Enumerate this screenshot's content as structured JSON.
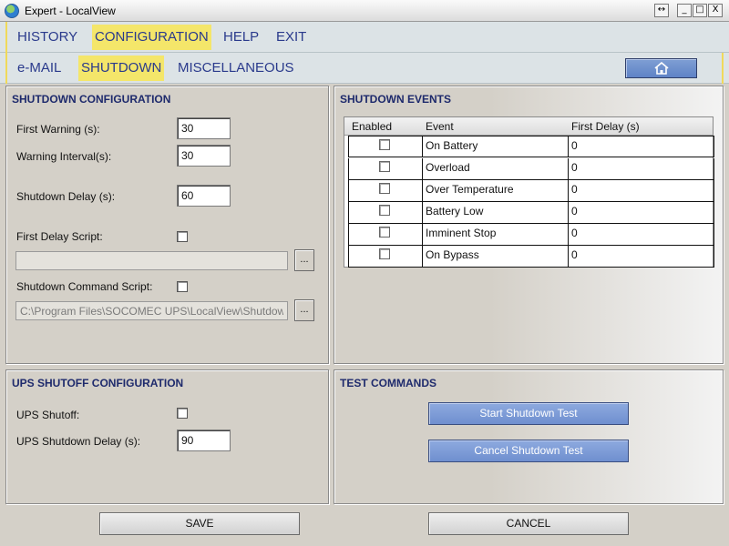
{
  "window": {
    "title": "Expert - LocalView",
    "controls": {
      "resize": "↔",
      "minimize": "_",
      "maximize": "□",
      "close": "X"
    }
  },
  "menu": {
    "main": [
      "HISTORY",
      "CONFIGURATION",
      "HELP",
      "EXIT"
    ],
    "main_active": "CONFIGURATION",
    "sub": [
      "e-MAIL",
      "SHUTDOWN",
      "MISCELLANEOUS"
    ],
    "sub_active": "SHUTDOWN",
    "home_icon": "home-icon"
  },
  "shutdown_config": {
    "title": "SHUTDOWN CONFIGURATION",
    "first_warning_label": "First Warning (s):",
    "first_warning_value": "30",
    "warning_interval_label": "Warning Interval(s):",
    "warning_interval_value": "30",
    "shutdown_delay_label": "Shutdown Delay (s):",
    "shutdown_delay_value": "60",
    "first_delay_script_label": "First Delay Script:",
    "first_delay_script_checked": false,
    "first_delay_script_path": "",
    "shutdown_command_script_label": "Shutdown Command Script:",
    "shutdown_command_script_checked": false,
    "shutdown_command_script_path": "C:\\Program Files\\SOCOMEC UPS\\LocalView\\Shutdown.l",
    "browse_label": "..."
  },
  "shutdown_events": {
    "title": "SHUTDOWN EVENTS",
    "columns": [
      "Enabled",
      "Event",
      "First Delay (s)"
    ],
    "rows": [
      {
        "enabled": false,
        "event": "On Battery",
        "delay": "0"
      },
      {
        "enabled": false,
        "event": "Overload",
        "delay": "0"
      },
      {
        "enabled": false,
        "event": "Over Temperature",
        "delay": "0"
      },
      {
        "enabled": false,
        "event": "Battery Low",
        "delay": "0"
      },
      {
        "enabled": false,
        "event": "Imminent Stop",
        "delay": "0"
      },
      {
        "enabled": false,
        "event": "On Bypass",
        "delay": "0"
      }
    ]
  },
  "ups_shutoff": {
    "title": "UPS SHUTOFF CONFIGURATION",
    "shutoff_label": "UPS Shutoff:",
    "shutoff_checked": false,
    "delay_label": "UPS Shutdown Delay (s):",
    "delay_value": "90"
  },
  "test_commands": {
    "title": "TEST COMMANDS",
    "start_label": "Start Shutdown Test",
    "cancel_label": "Cancel Shutdown Test"
  },
  "footer": {
    "save_label": "SAVE",
    "cancel_label": "CANCEL"
  },
  "colors": {
    "menu_text": "#2a3a8c",
    "menu_active_bg": "#f4e66a",
    "panel_title": "#1e2a6c",
    "blue_button": "#7a99d6"
  }
}
